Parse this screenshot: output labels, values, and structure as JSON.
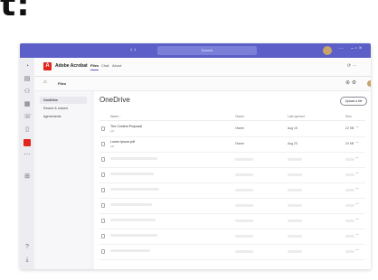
{
  "heading": "t:",
  "colors": {
    "teams_purple": "#5b5fc7",
    "acrobat_red": "#e0251b"
  },
  "titlebar": {
    "nav": "‹ ›",
    "search_placeholder": "Search",
    "more": "···",
    "window_controls": "– ▫ ×"
  },
  "rail": {
    "icons": [
      "activity-icon",
      "chat-icon",
      "teams-icon",
      "calendar-icon",
      "calls-icon",
      "files-icon",
      "acrobat-icon",
      "more-apps-icon",
      "apps-icon",
      "help-icon",
      "download-icon"
    ]
  },
  "app": {
    "logo_letter": "A",
    "name": "Adobe Acrobat",
    "tabs": [
      "Files",
      "Chat",
      "About"
    ],
    "active_tab": "Files",
    "right_icons": "⟳ ⋯"
  },
  "subbar": {
    "home_icon": "⌂",
    "title": "Files",
    "right_icons": "⊕ ⚙"
  },
  "nav": {
    "items": [
      "OneDrive",
      "Recent & shared",
      "Agreements"
    ],
    "active": "OneDrive"
  },
  "content": {
    "title": "OneDrive",
    "upload_button": "Upload a file",
    "columns": [
      "Name ↓",
      "Owner",
      "Last opened",
      "Size"
    ],
    "rows": [
      {
        "name": "The Content Proposal",
        "sub": "pdf",
        "owner": "Owner",
        "date": "Aug 15",
        "size": "22 KB",
        "more": "···"
      },
      {
        "name": "Lorem Ipsum.pdf",
        "sub": "pdf",
        "owner": "Owner",
        "date": "Aug 23",
        "size": "24 KB",
        "more": "···"
      }
    ],
    "placeholder_more": "···"
  }
}
